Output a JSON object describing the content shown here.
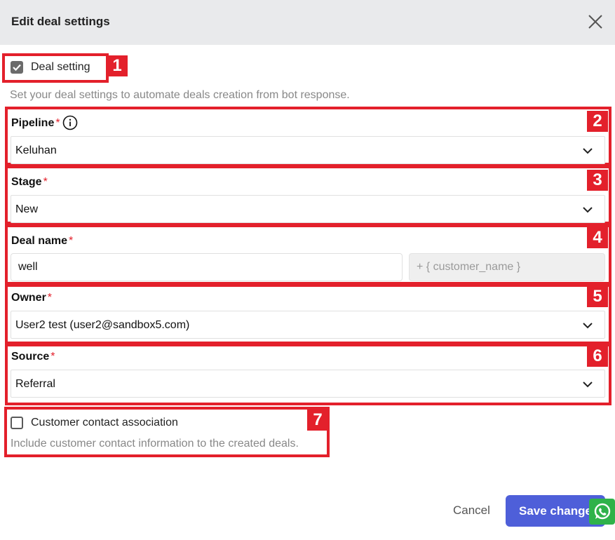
{
  "header": {
    "title": "Edit deal settings",
    "close_icon": "close-icon"
  },
  "deal_setting": {
    "checkbox_label": "Deal setting",
    "checked": true,
    "description": "Set your deal settings to automate deals creation from bot response.",
    "badge": "1"
  },
  "pipeline": {
    "label": "Pipeline",
    "required_mark": "*",
    "value": "Keluhan",
    "badge": "2",
    "info_icon": "info-icon"
  },
  "stage": {
    "label": "Stage",
    "required_mark": "*",
    "value": "New",
    "badge": "3"
  },
  "deal_name": {
    "label": "Deal name",
    "required_mark": "*",
    "value": "well",
    "suffix_value": "+ { customer_name }",
    "badge": "4"
  },
  "owner": {
    "label": "Owner",
    "required_mark": "*",
    "value": "User2 test (user2@sandbox5.com)",
    "badge": "5"
  },
  "source": {
    "label": "Source",
    "required_mark": "*",
    "value": "Referral",
    "badge": "6"
  },
  "customer_contact": {
    "checkbox_label": "Customer contact association",
    "checked": false,
    "description": "Include customer contact information to the created deals.",
    "badge": "7"
  },
  "footer": {
    "cancel_label": "Cancel",
    "save_label": "Save changes"
  },
  "colors": {
    "annotation_red": "#e3202b",
    "primary": "#4e5fd9",
    "whatsapp_green": "#2fb24a",
    "header_bg": "#e9eaec"
  }
}
